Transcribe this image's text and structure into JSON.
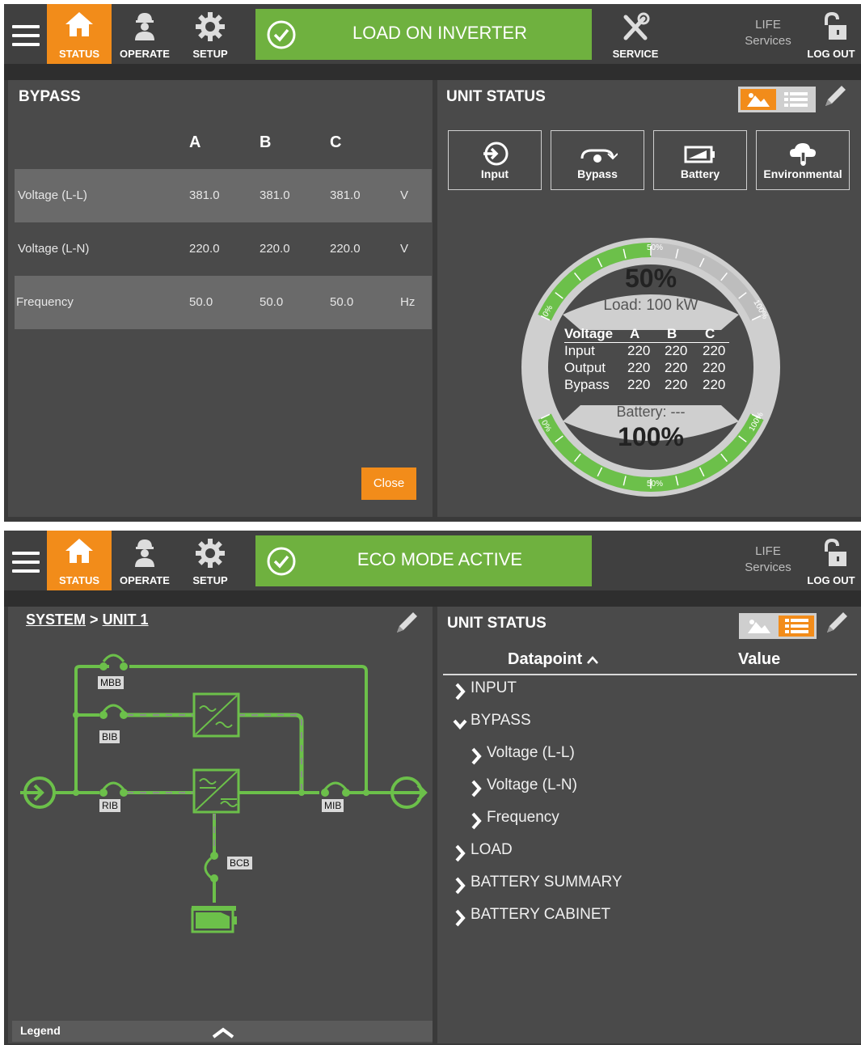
{
  "nav": {
    "status": "STATUS",
    "operate": "OPERATE",
    "setup": "SETUP",
    "service": "SERVICE",
    "life_line1": "LIFE",
    "life_line2": "Services",
    "logout": "LOG OUT"
  },
  "colors": {
    "accent": "#f28c1a",
    "ok_green": "#6fb13f",
    "diagram_green": "#6cc04a",
    "bg_dark": "#3a3a3a",
    "panel": "#4a4a4a"
  },
  "screen1": {
    "banner": "LOAD ON INVERTER",
    "left_panel": {
      "title": "BYPASS",
      "columns": [
        "A",
        "B",
        "C"
      ],
      "rows": [
        {
          "label": "Voltage (L-L)",
          "a": "381.0",
          "b": "381.0",
          "c": "381.0",
          "unit": "V"
        },
        {
          "label": "Voltage (L-N)",
          "a": "220.0",
          "b": "220.0",
          "c": "220.0",
          "unit": "V"
        },
        {
          "label": "Frequency",
          "a": "50.0",
          "b": "50.0",
          "c": "50.0",
          "unit": "Hz"
        }
      ],
      "close_label": "Close"
    },
    "right_panel": {
      "title": "UNIT STATUS",
      "active_view": "image",
      "tiles": [
        {
          "label": "Input",
          "icon": "input-icon"
        },
        {
          "label": "Bypass",
          "icon": "bypass-icon"
        },
        {
          "label": "Battery",
          "icon": "battery-icon"
        },
        {
          "label": "Environmental",
          "icon": "environmental-icon"
        }
      ],
      "gauge": {
        "load_percent_text": "50%",
        "load_fraction": 0.5,
        "load_text": "Load: 100 kW",
        "battery_text": "Battery: ---",
        "battery_percent_text": "100%",
        "battery_fraction": 1.0,
        "top_scale": {
          "min": "0%",
          "mid": "50%",
          "max": "100%"
        },
        "bottom_scale": {
          "min": "0%",
          "mid": "50%",
          "max": "100%"
        },
        "voltage_header": [
          "Voltage",
          "A",
          "B",
          "C"
        ],
        "voltage_rows": [
          {
            "label": "Input",
            "a": "220",
            "b": "220",
            "c": "220"
          },
          {
            "label": "Output",
            "a": "220",
            "b": "220",
            "c": "220"
          },
          {
            "label": "Bypass",
            "a": "220",
            "b": "220",
            "c": "220"
          }
        ]
      }
    }
  },
  "screen2": {
    "banner": "ECO MODE ACTIVE",
    "breadcrumb": {
      "root": "SYSTEM",
      "separator": ">",
      "current": "UNIT 1"
    },
    "diagram_labels": {
      "mbb": "MBB",
      "bib": "BIB",
      "rib": "RIB",
      "mib": "MIB",
      "bcb": "BCB"
    },
    "legend": "Legend",
    "right_panel": {
      "title": "UNIT STATUS",
      "active_view": "list",
      "header_datapoint": "Datapoint",
      "header_value": "Value",
      "tree": [
        {
          "label": "INPUT",
          "expanded": false,
          "level": 0
        },
        {
          "label": "BYPASS",
          "expanded": true,
          "level": 0
        },
        {
          "label": "Voltage (L-L)",
          "expanded": false,
          "level": 1
        },
        {
          "label": "Voltage (L-N)",
          "expanded": false,
          "level": 1
        },
        {
          "label": "Frequency",
          "expanded": false,
          "level": 1
        },
        {
          "label": "LOAD",
          "expanded": false,
          "level": 0
        },
        {
          "label": "BATTERY SUMMARY",
          "expanded": false,
          "level": 0
        },
        {
          "label": "BATTERY CABINET",
          "expanded": false,
          "level": 0
        }
      ]
    }
  }
}
